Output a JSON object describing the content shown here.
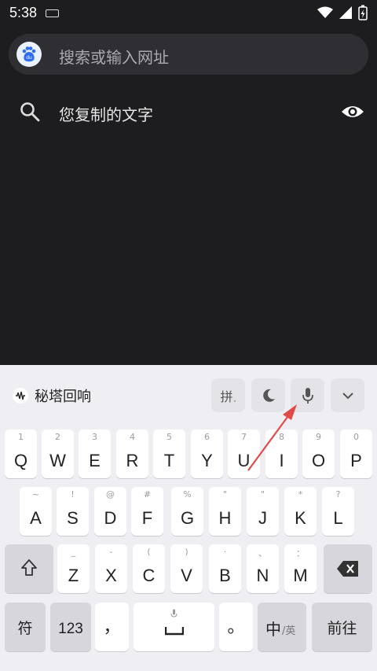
{
  "status": {
    "time": "5:38"
  },
  "search": {
    "placeholder": "搜索或输入网址",
    "logo_text": "du"
  },
  "suggestion": {
    "text": "您复制的文字"
  },
  "keyboard": {
    "brand": "秘塔回响",
    "toolbar": {
      "pinyin": "拼"
    },
    "rows": [
      [
        {
          "k": "Q",
          "h": "1"
        },
        {
          "k": "W",
          "h": "2"
        },
        {
          "k": "E",
          "h": "3"
        },
        {
          "k": "R",
          "h": "4"
        },
        {
          "k": "T",
          "h": "5"
        },
        {
          "k": "Y",
          "h": "6"
        },
        {
          "k": "U",
          "h": "7"
        },
        {
          "k": "I",
          "h": "8"
        },
        {
          "k": "O",
          "h": "9"
        },
        {
          "k": "P",
          "h": "0"
        }
      ],
      [
        {
          "k": "A",
          "h": "~"
        },
        {
          "k": "S",
          "h": "!"
        },
        {
          "k": "D",
          "h": "@"
        },
        {
          "k": "F",
          "h": "#"
        },
        {
          "k": "G",
          "h": "%"
        },
        {
          "k": "H",
          "h": "\""
        },
        {
          "k": "J",
          "h": "\""
        },
        {
          "k": "K",
          "h": "*"
        },
        {
          "k": "L",
          "h": "?"
        }
      ],
      [
        {
          "k": "Z",
          "h": "_"
        },
        {
          "k": "X",
          "h": "-"
        },
        {
          "k": "C",
          "h": "("
        },
        {
          "k": "V",
          "h": ")"
        },
        {
          "k": "B",
          "h": "·"
        },
        {
          "k": "N",
          "h": "、"
        },
        {
          "k": "M",
          "h": "："
        }
      ]
    ],
    "bottom": {
      "symbols": "符",
      "numbers": "123",
      "comma": "，",
      "period": "。",
      "lang_main": "中",
      "lang_sub": "/英",
      "enter": "前往"
    }
  }
}
